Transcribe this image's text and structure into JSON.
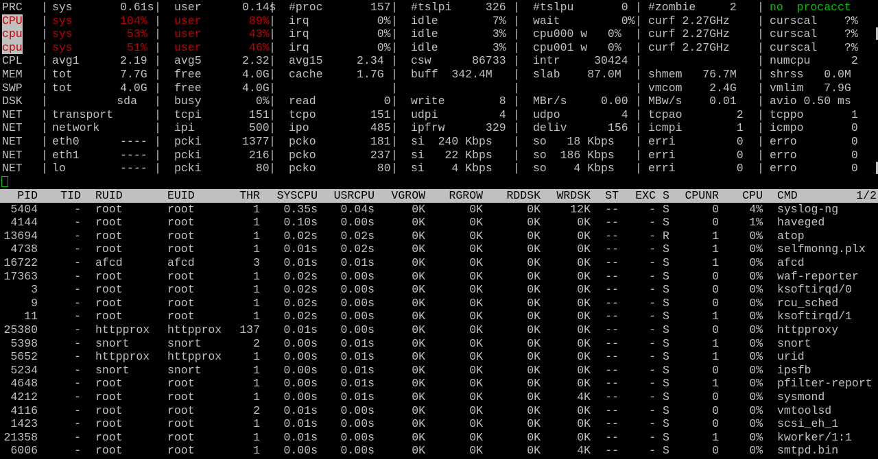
{
  "summary": {
    "prc": {
      "label": "PRC",
      "sys": "sys       0.61s",
      "user": "user      0.14s",
      "nproc": "#proc       157",
      "tslpi": "#tslpi     326",
      "tslpu": "#tslpu       0",
      "zombie": "#zombie     2",
      "procacct": "no  procacct"
    },
    "cpu": {
      "label": "CPU",
      "sys": "sys       104%",
      "user": "user       89%",
      "irq": "irq          0%",
      "idle": "idle        7%",
      "wait": "wait         0%",
      "curf": "curf 2.27GHz",
      "curscal": "curscal    ?%"
    },
    "cpu0": {
      "label": "cpu",
      "sys": "sys        53%",
      "user": "user       43%",
      "irq": "irq          0%",
      "idle": "idle        3%",
      "cpu": "cpu000 w   0%",
      "curf": "curf 2.27GHz",
      "curscal": "curscal    ?%"
    },
    "cpu1": {
      "label": "cpu",
      "sys": "sys        51%",
      "user": "user       46%",
      "irq": "irq          0%",
      "idle": "idle        3%",
      "cpu": "cpu001 w   0%",
      "curf": "curf 2.27GHz",
      "curscal": "curscal    ?%"
    },
    "cpl": {
      "label": "CPL",
      "avg1": "avg1      2.19",
      "avg5": "avg5      2.32",
      "avg15": "avg15     2.34",
      "csw": "csw      86733",
      "intr": "intr     30424",
      "numcpu": "numcpu      2"
    },
    "mem": {
      "label": "MEM",
      "tot": "tot       7.7G",
      "free": "free      4.0G",
      "cache": "cache     1.7G",
      "buff": "buff  342.4M",
      "slab": "slab    87.0M",
      "shmem": "shmem   76.7M",
      "shrss": "shrss   0.0M"
    },
    "swp": {
      "label": "SWP",
      "tot": "tot       4.0G",
      "free": "free      4.0G",
      "vmcom": "vmcom    2.4G",
      "vmlim": "vmlim   7.9G"
    },
    "dsk": {
      "label": "DSK",
      "name": "sda",
      "busy": "busy        0%",
      "read": "read          0",
      "write": "write        8",
      "mbr": "MBr/s     0.00",
      "mbw": "MBw/s    0.01",
      "avio": "avio 0.50 ms"
    },
    "net_transport": {
      "label": "NET",
      "a": "transport",
      "b": "tcpi       151",
      "c": "tcpo        151",
      "d": "udpi         4",
      "e": "udpo         4",
      "f": "tcpao        2",
      "g": "tcppo       1"
    },
    "net_network": {
      "label": "NET",
      "a": "network",
      "b": "ipi        500",
      "c": "ipo         485",
      "d": "ipfrw      329",
      "e": "deliv      156",
      "f": "icmpi        1",
      "g": "icmpo       0"
    },
    "net_eth0": {
      "label": "NET",
      "a": "eth0      ----",
      "b": "pcki      1377",
      "c": "pcko        181",
      "d": "si  240 Kbps",
      "e": "so   18 Kbps",
      "f": "erri         0",
      "g": "erro        0"
    },
    "net_eth1": {
      "label": "NET",
      "a": "eth1      ----",
      "b": "pcki       216",
      "c": "pcko        237",
      "d": "si   22 Kbps",
      "e": "so  186 Kbps",
      "f": "erri         0",
      "g": "erro        0"
    },
    "net_lo": {
      "label": "NET",
      "a": "lo        ----",
      "b": "pcki        80",
      "c": "pcko         80",
      "d": "si    4 Kbps",
      "e": "so    4 Kbps",
      "f": "erri         0",
      "g": "erro        0"
    }
  },
  "table": {
    "headers": [
      "PID",
      "TID",
      "RUID",
      "EUID",
      "THR",
      "SYSCPU",
      "USRCPU",
      "VGROW",
      "RGROW",
      "RDDSK",
      "WRDSK",
      "ST",
      "EXC",
      "S",
      "CPUNR",
      "CPU",
      "CMD"
    ],
    "page": "1/2",
    "rows": [
      [
        "5404",
        "-",
        "root",
        "root",
        "1",
        "0.35s",
        "0.04s",
        "0K",
        "0K",
        "0K",
        "12K",
        "--",
        "-",
        "S",
        "0",
        "4%",
        "syslog-ng"
      ],
      [
        "4144",
        "-",
        "root",
        "root",
        "1",
        "0.10s",
        "0.00s",
        "0K",
        "0K",
        "0K",
        "0K",
        "--",
        "-",
        "S",
        "0",
        "1%",
        "haveged"
      ],
      [
        "13694",
        "-",
        "root",
        "root",
        "1",
        "0.02s",
        "0.02s",
        "0K",
        "0K",
        "0K",
        "0K",
        "--",
        "-",
        "R",
        "1",
        "0%",
        "atop"
      ],
      [
        "4738",
        "-",
        "root",
        "root",
        "1",
        "0.01s",
        "0.02s",
        "0K",
        "0K",
        "0K",
        "0K",
        "--",
        "-",
        "S",
        "1",
        "0%",
        "selfmonng.plx"
      ],
      [
        "16722",
        "-",
        "afcd",
        "afcd",
        "3",
        "0.01s",
        "0.01s",
        "0K",
        "0K",
        "0K",
        "0K",
        "--",
        "-",
        "S",
        "1",
        "0%",
        "afcd"
      ],
      [
        "17363",
        "-",
        "root",
        "root",
        "1",
        "0.02s",
        "0.00s",
        "0K",
        "0K",
        "0K",
        "0K",
        "--",
        "-",
        "S",
        "0",
        "0%",
        "waf-reporter"
      ],
      [
        "3",
        "-",
        "root",
        "root",
        "1",
        "0.02s",
        "0.00s",
        "0K",
        "0K",
        "0K",
        "0K",
        "--",
        "-",
        "S",
        "0",
        "0%",
        "ksoftirqd/0"
      ],
      [
        "9",
        "-",
        "root",
        "root",
        "1",
        "0.02s",
        "0.00s",
        "0K",
        "0K",
        "0K",
        "0K",
        "--",
        "-",
        "S",
        "0",
        "0%",
        "rcu_sched"
      ],
      [
        "11",
        "-",
        "root",
        "root",
        "1",
        "0.02s",
        "0.00s",
        "0K",
        "0K",
        "0K",
        "0K",
        "--",
        "-",
        "S",
        "1",
        "0%",
        "ksoftirqd/1"
      ],
      [
        "25380",
        "-",
        "httpprox",
        "httpprox",
        "137",
        "0.01s",
        "0.00s",
        "0K",
        "0K",
        "0K",
        "0K",
        "--",
        "-",
        "S",
        "0",
        "0%",
        "httpproxy"
      ],
      [
        "5398",
        "-",
        "snort",
        "snort",
        "2",
        "0.00s",
        "0.01s",
        "0K",
        "0K",
        "0K",
        "0K",
        "--",
        "-",
        "S",
        "1",
        "0%",
        "snort"
      ],
      [
        "5652",
        "-",
        "httpprox",
        "httpprox",
        "1",
        "0.00s",
        "0.01s",
        "0K",
        "0K",
        "0K",
        "0K",
        "--",
        "-",
        "S",
        "1",
        "0%",
        "urid"
      ],
      [
        "5234",
        "-",
        "snort",
        "snort",
        "1",
        "0.00s",
        "0.01s",
        "0K",
        "0K",
        "0K",
        "0K",
        "--",
        "-",
        "S",
        "0",
        "0%",
        "ipsfb"
      ],
      [
        "4648",
        "-",
        "root",
        "root",
        "1",
        "0.00s",
        "0.01s",
        "0K",
        "0K",
        "0K",
        "0K",
        "--",
        "-",
        "S",
        "1",
        "0%",
        "pfilter-report"
      ],
      [
        "4212",
        "-",
        "root",
        "root",
        "1",
        "0.00s",
        "0.01s",
        "0K",
        "0K",
        "0K",
        "4K",
        "--",
        "-",
        "S",
        "0",
        "0%",
        "sysmond"
      ],
      [
        "4116",
        "-",
        "root",
        "root",
        "2",
        "0.01s",
        "0.00s",
        "0K",
        "0K",
        "0K",
        "0K",
        "--",
        "-",
        "S",
        "0",
        "0%",
        "vmtoolsd"
      ],
      [
        "1423",
        "-",
        "root",
        "root",
        "1",
        "0.01s",
        "0.00s",
        "0K",
        "0K",
        "0K",
        "0K",
        "--",
        "-",
        "S",
        "0",
        "0%",
        "scsi_eh_1"
      ],
      [
        "21358",
        "-",
        "root",
        "root",
        "1",
        "0.01s",
        "0.00s",
        "0K",
        "0K",
        "0K",
        "0K",
        "--",
        "-",
        "S",
        "1",
        "0%",
        "kworker/1:1"
      ],
      [
        "6006",
        "-",
        "root",
        "root",
        "1",
        "0.00s",
        "0.00s",
        "0K",
        "0K",
        "0K",
        "4K",
        "--",
        "-",
        "S",
        "0",
        "0%",
        "smtpd.bin"
      ]
    ]
  }
}
